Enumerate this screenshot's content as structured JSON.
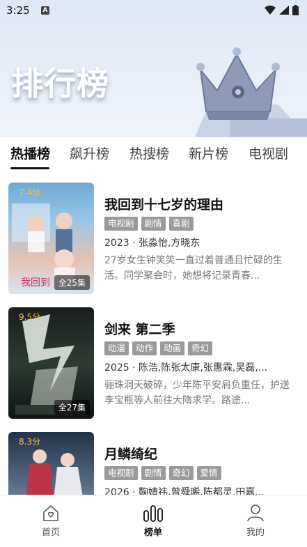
{
  "status_bar": {
    "time": "3:25",
    "notification_badge": "A"
  },
  "banner": {
    "title": "排行榜"
  },
  "tabs": [
    {
      "label": "热播榜",
      "active": true
    },
    {
      "label": "飙升榜",
      "active": false
    },
    {
      "label": "热搜榜",
      "active": false
    },
    {
      "label": "新片榜",
      "active": false
    },
    {
      "label": "电视剧",
      "active": false
    }
  ],
  "items": [
    {
      "score": "7.4分",
      "episodes": "全25集",
      "title": "我回到十七岁的理由",
      "tags": [
        "电视剧",
        "剧情",
        "喜剧"
      ],
      "meta": "2023 · 张淼怡,方晓东",
      "description": "27岁女生钟笑笑一直过着普通且忙碌的生活。同学聚会时，她想将记录青春...",
      "poster_colors": [
        "#7fb2d8",
        "#e9b9a6"
      ]
    },
    {
      "score": "9.5分",
      "episodes": "全27集",
      "title": "剑来 第二季",
      "tags": [
        "动漫",
        "动作",
        "动画",
        "奇幻"
      ],
      "meta": "2025 · 陈浩,陈张太康,张惠霖,吴磊,...",
      "description": "骊珠洞天破碎，少年陈平安肩负重任，护送李宝瓶等人前往大隋求学。路途...",
      "poster_colors": [
        "#1d2a22",
        "#5a6b55"
      ]
    },
    {
      "score": "8.3分",
      "episodes": "",
      "title": "月鳞绮纪",
      "tags": [
        "电视剧",
        "剧情",
        "奇幻",
        "爱情"
      ],
      "meta": "2026 · 鞠婧祎,曾舜晞,陈都灵,田嘉...",
      "description": "",
      "poster_colors": [
        "#2a3f5a",
        "#a8b8c8"
      ]
    }
  ],
  "bottom_nav": [
    {
      "label": "首页",
      "icon": "home-icon",
      "active": false
    },
    {
      "label": "榜单",
      "icon": "ranking-icon",
      "active": true
    },
    {
      "label": "我的",
      "icon": "profile-icon",
      "active": false
    }
  ]
}
